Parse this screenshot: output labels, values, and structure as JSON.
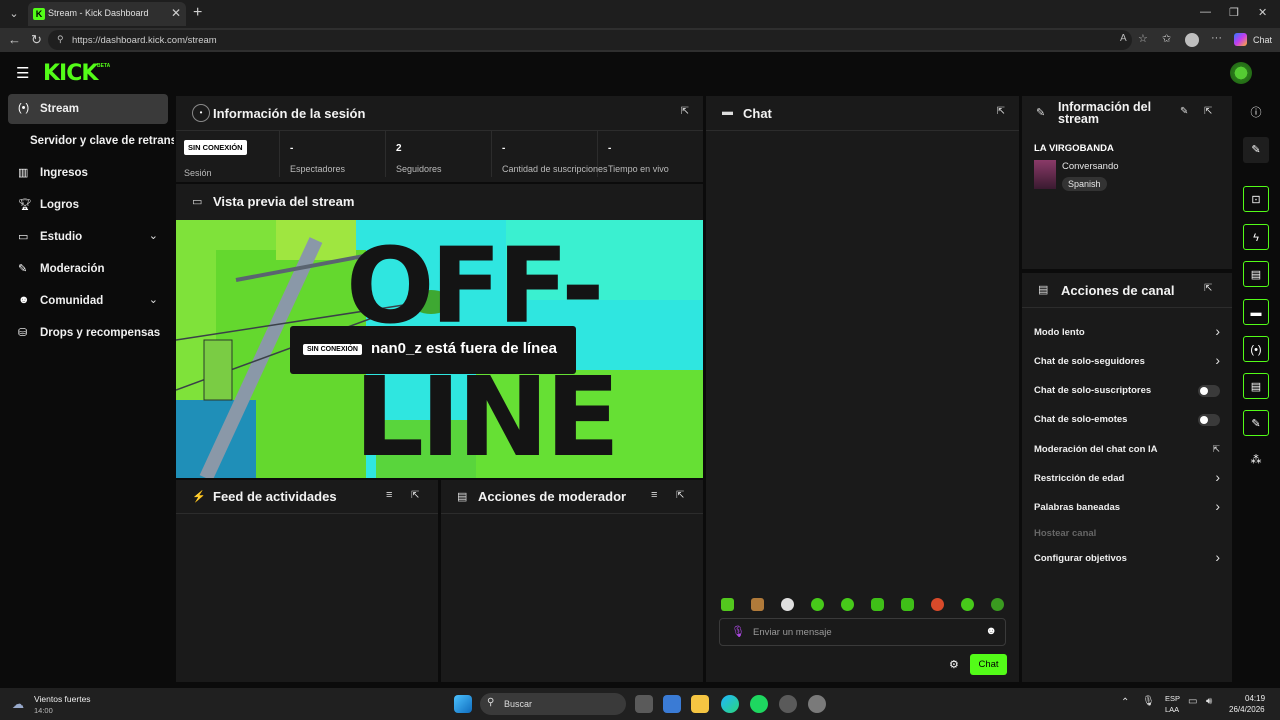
{
  "browser": {
    "tab_title": "Stream - Kick Dashboard",
    "url": "https://dashboard.kick.com/stream",
    "chat_button": "Chat"
  },
  "topnav": {
    "logo": "KICK",
    "beta": "BETA"
  },
  "sidebar": {
    "items": [
      {
        "label": "Stream",
        "icon": "broadcast-icon",
        "active": true
      },
      {
        "label": "Servidor y clave de retransn",
        "icon": "",
        "active": false
      },
      {
        "label": "Ingresos",
        "icon": "bar-chart-icon",
        "active": false
      },
      {
        "label": "Logros",
        "icon": "trophy-icon",
        "active": false
      },
      {
        "label": "Estudio",
        "icon": "studio-icon",
        "active": false
      },
      {
        "label": "Moderación",
        "icon": "wrench-icon",
        "active": false
      },
      {
        "label": "Comunidad",
        "icon": "community-icon",
        "active": false
      },
      {
        "label": "Drops y recompensas",
        "icon": "drops-icon",
        "active": false
      }
    ]
  },
  "session": {
    "title": "Información de la sesión",
    "status_badge": "SIN CONEXIÓN",
    "status_label": "Sesión",
    "stats": [
      {
        "value": "-",
        "label": "Espectadores"
      },
      {
        "value": "2",
        "label": "Seguidores"
      },
      {
        "value": "-",
        "label": "Cantidad de suscripciones"
      },
      {
        "value": "-",
        "label": "Tiempo en vivo"
      }
    ]
  },
  "preview": {
    "title": "Vista previa del stream",
    "offline_badge": "SIN CONEXIÓN",
    "offline_text": "nan0_z está fuera de línea",
    "art_text_1": "OFF-",
    "art_text_2": "LINE"
  },
  "feed": {
    "title": "Feed de actividades"
  },
  "mod_actions": {
    "title": "Acciones de moderador"
  },
  "chat": {
    "title": "Chat",
    "input_placeholder": "Enviar un mensaje",
    "send_label": "Chat"
  },
  "stream_info": {
    "title_line1": "Información del",
    "title_line2": "stream",
    "stream_title": "LA VIRGOBANDA",
    "category": "Conversando",
    "language": "Spanish"
  },
  "channel_actions": {
    "title": "Acciones de canal",
    "rows": [
      {
        "label": "Modo lento",
        "control": "arrow"
      },
      {
        "label": "Chat de solo-seguidores",
        "control": "arrow"
      },
      {
        "label": "Chat de solo-suscriptores",
        "control": "toggle"
      },
      {
        "label": "Chat de solo-emotes",
        "control": "toggle"
      },
      {
        "label": "Moderación del chat con IA",
        "control": "external"
      },
      {
        "label": "Restricción de edad",
        "control": "arrow"
      },
      {
        "label": "Palabras baneadas",
        "control": "arrow"
      },
      {
        "label": "Hostear canal",
        "control": "disabled"
      },
      {
        "label": "Configurar objetivos",
        "control": "arrow"
      }
    ]
  },
  "taskbar": {
    "weather_title": "Vientos fuertes",
    "weather_temp": "14:00",
    "search_placeholder": "Buscar",
    "lang1": "ESP",
    "lang2": "LAA",
    "time": "04:19",
    "date": "26/4/2026"
  },
  "colors": {
    "accent": "#53fc18",
    "panel": "#1a1a1a",
    "background": "#0b0b0b"
  }
}
